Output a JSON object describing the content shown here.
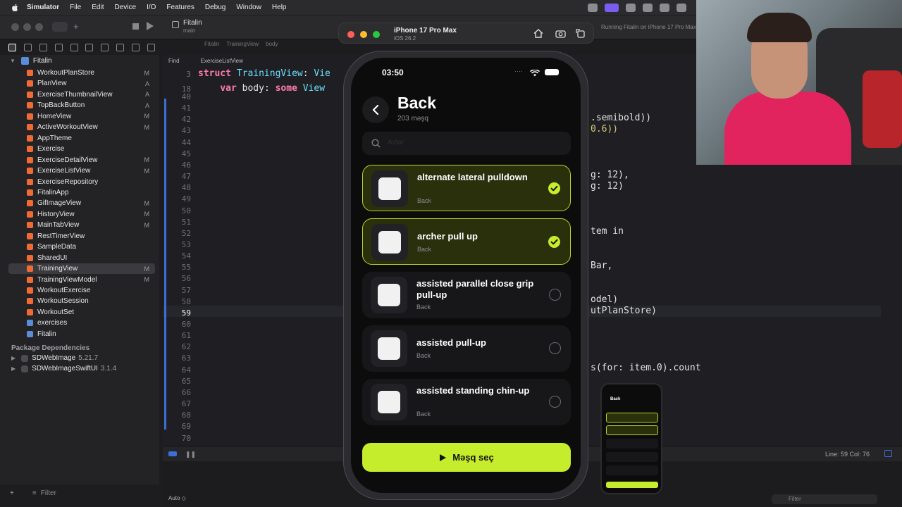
{
  "menubar": {
    "app_name": "Simulator",
    "items": [
      "File",
      "Edit",
      "Device",
      "I/O",
      "Features",
      "Debug",
      "Window",
      "Help"
    ]
  },
  "xcode": {
    "scheme_title": "Fitalin",
    "scheme_branch": "main",
    "run_status": "Running Fitalin on iPhone 17 Pro Max",
    "jump_find": "Find",
    "jump_file": "ExerciseListView",
    "crumbs": [
      "Fitalin",
      "TrainingView",
      "body"
    ],
    "project_name": "Fitalin",
    "files": [
      {
        "name": "WorkoutPlanStore",
        "badge": "M"
      },
      {
        "name": "PlanView",
        "badge": "A"
      },
      {
        "name": "ExerciseThumbnailView",
        "badge": "A"
      },
      {
        "name": "TopBackButton",
        "badge": "A"
      },
      {
        "name": "HomeView",
        "badge": "M"
      },
      {
        "name": "ActiveWorkoutView",
        "badge": "M"
      },
      {
        "name": "AppTheme",
        "badge": ""
      },
      {
        "name": "Exercise",
        "badge": ""
      },
      {
        "name": "ExerciseDetailView",
        "badge": "M"
      },
      {
        "name": "ExerciseListView",
        "badge": "M"
      },
      {
        "name": "ExerciseRepository",
        "badge": ""
      },
      {
        "name": "FitalinApp",
        "badge": ""
      },
      {
        "name": "GifImageView",
        "badge": "M"
      },
      {
        "name": "HistoryView",
        "badge": "M"
      },
      {
        "name": "MainTabView",
        "badge": "M"
      },
      {
        "name": "RestTimerView",
        "badge": ""
      },
      {
        "name": "SampleData",
        "badge": ""
      },
      {
        "name": "SharedUI",
        "badge": ""
      },
      {
        "name": "TrainingView",
        "badge": "M"
      },
      {
        "name": "TrainingViewModel",
        "badge": "M"
      },
      {
        "name": "WorkoutExercise",
        "badge": ""
      },
      {
        "name": "WorkoutSession",
        "badge": ""
      },
      {
        "name": "WorkoutSet",
        "badge": ""
      },
      {
        "name": "exercises",
        "badge": ""
      },
      {
        "name": "Fitalin",
        "badge": ""
      }
    ],
    "package_header": "Package Dependencies",
    "packages": [
      {
        "name": "SDWebImage",
        "version": "5.21.7"
      },
      {
        "name": "SDWebImageSwiftUI",
        "version": "3.1.4"
      }
    ],
    "filter_placeholder": "Filter",
    "right_filter_placeholder": "Filter",
    "line_col": "Line: 59  Col: 76",
    "auto_label": "Auto ◇",
    "sticky_lines": [
      {
        "num": "3",
        "code": "struct TrainingView: Vie"
      },
      {
        "num": "18",
        "code": "    var body: some View"
      }
    ],
    "line_numbers": [
      "40",
      "41",
      "42",
      "43",
      "44",
      "45",
      "46",
      "47",
      "48",
      "49",
      "50",
      "51",
      "52",
      "53",
      "54",
      "55",
      "56",
      "57",
      "58",
      "59",
      "60",
      "61",
      "62",
      "63",
      "64",
      "65",
      "66",
      "67",
      "68",
      "69",
      "70"
    ],
    "current_line": "59",
    "code_fragments": {
      "semibold": ".semibold))",
      "opacity": "0.6))",
      "pad1": "g: 12),",
      "pad2": "g: 12)",
      "item_in": "tem in",
      "bar": "Bar,",
      "model": "odel)",
      "store": "utPlanStore)",
      "count": "s(for: item.0).count"
    }
  },
  "simulator": {
    "device_name": "iPhone 17 Pro Max",
    "os_version": "iOS 26.2"
  },
  "phone": {
    "time": "03:50",
    "title": "Back",
    "count_label": "203 məşq",
    "search_placeholder": "Axtar",
    "cards": [
      {
        "title": "alternate lateral pulldown",
        "subtitle": "Back",
        "selected": true
      },
      {
        "title": "archer pull up",
        "subtitle": "Back",
        "selected": true
      },
      {
        "title": "assisted parallel close grip pull-up",
        "subtitle": "Back",
        "selected": false
      },
      {
        "title": "assisted pull-up",
        "subtitle": "Back",
        "selected": false
      },
      {
        "title": "assisted standing chin-up",
        "subtitle": "Back",
        "selected": false
      }
    ],
    "cta_label": "Məşq seç",
    "accent": "#c6ed2c"
  },
  "mini_preview": {
    "title": "Back"
  }
}
